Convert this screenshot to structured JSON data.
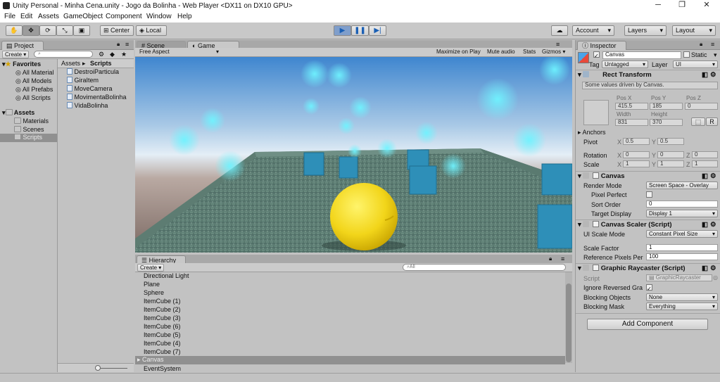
{
  "window": {
    "title": "Unity Personal - Minha Cena.unity - Jogo da Bolinha - Web Player <DX11 on DX10 GPU>",
    "minimize": "─",
    "maximize": "❐",
    "close": "✕"
  },
  "menu": [
    "File",
    "Edit",
    "Assets",
    "GameObject",
    "Component",
    "Window",
    "Help"
  ],
  "toolbar": {
    "pivot_label": "Center",
    "space_label": "Local",
    "account_label": "Account",
    "layers_label": "Layers",
    "layout_label": "Layout",
    "play_playing": true
  },
  "project": {
    "tab": "Project",
    "create": "Create",
    "favorites_label": "Favorites",
    "favorites": [
      "All Material",
      "All Models",
      "All Prefabs",
      "All Scripts"
    ],
    "assets_label": "Assets",
    "asset_folders": [
      "Materials",
      "Scenes",
      "Scripts"
    ],
    "selected_folder": "Scripts",
    "breadcrumb_root": "Assets",
    "breadcrumb_current": "Scripts",
    "files": [
      "DestroiParticula",
      "GiraItem",
      "MoveCamera",
      "MovimentaBolinha",
      "VidaBolinha"
    ]
  },
  "scene_tabs": {
    "scene": "Scene",
    "game": "Game"
  },
  "game": {
    "aspect": "Free Aspect",
    "maximize_on_play": "Maximize on Play",
    "mute_audio": "Mute audio",
    "stats": "Stats",
    "gizmos": "Gizmos"
  },
  "hierarchy": {
    "tab": "Hierarchy",
    "create": "Create",
    "search_placeholder": "All",
    "items": [
      "Directional Light",
      "Plane",
      "Sphere",
      "ItemCube (1)",
      "ItemCube (2)",
      "ItemCube (3)",
      "ItemCube (6)",
      "ItemCube (5)",
      "ItemCube (4)",
      "ItemCube (7)",
      "Canvas",
      "EventSystem"
    ],
    "selected": "Canvas"
  },
  "inspector": {
    "tab": "Inspector",
    "object_name": "Canvas",
    "static_label": "Static",
    "tag_label": "Tag",
    "tag_value": "Untagged",
    "layer_label": "Layer",
    "layer_value": "UI",
    "rect_transform": {
      "title": "Rect Transform",
      "note": "Some values driven by Canvas.",
      "posx_label": "Pos X",
      "posy_label": "Pos Y",
      "posz_label": "Pos Z",
      "posx": "415.5",
      "posy": "185",
      "posz": "0",
      "width_label": "Width",
      "height_label": "Height",
      "width": "831",
      "height": "370",
      "r_button": "R",
      "anchors": "Anchors",
      "pivot_label": "Pivot",
      "pivot_x": "0.5",
      "pivot_y": "0.5",
      "rotation_label": "Rotation",
      "rot_x": "0",
      "rot_y": "0",
      "rot_z": "0",
      "scale_label": "Scale",
      "scale_x": "1",
      "scale_y": "1",
      "scale_z": "1",
      "x": "X",
      "y": "Y",
      "z": "Z"
    },
    "canvas": {
      "title": "Canvas",
      "render_mode_label": "Render Mode",
      "render_mode": "Screen Space - Overlay",
      "pixel_perfect_label": "Pixel Perfect",
      "sort_order_label": "Sort Order",
      "sort_order": "0",
      "target_display_label": "Target Display",
      "target_display": "Display 1"
    },
    "canvas_scaler": {
      "title": "Canvas Scaler (Script)",
      "ui_scale_mode_label": "UI Scale Mode",
      "ui_scale_mode": "Constant Pixel Size",
      "scale_factor_label": "Scale Factor",
      "scale_factor": "1",
      "ref_pixels_label": "Reference Pixels Per",
      "ref_pixels": "100"
    },
    "raycaster": {
      "title": "Graphic Raycaster (Script)",
      "script_label": "Script",
      "script_value": "GraphicRaycaster",
      "ignore_label": "Ignore Reversed Gra",
      "blocking_objects_label": "Blocking Objects",
      "blocking_objects": "None",
      "blocking_mask_label": "Blocking Mask",
      "blocking_mask": "Everything"
    },
    "add_component": "Add Component"
  }
}
